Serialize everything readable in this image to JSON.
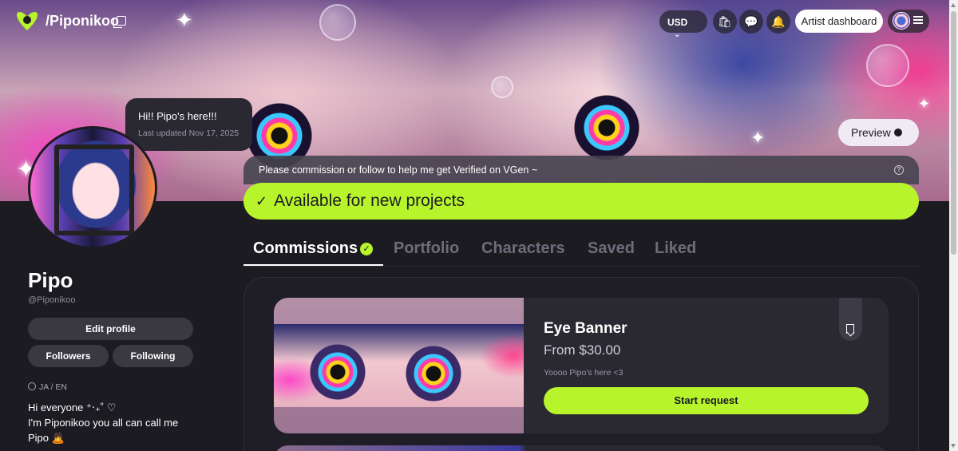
{
  "header": {
    "site_handle": "/Piponikoo",
    "currency": "USD",
    "artist_dashboard_label": "Artist dashboard",
    "icons": [
      "logo-icon",
      "copy-icon",
      "chevron-down-icon",
      "cart-icon",
      "chat-icon",
      "bell-icon",
      "avatar",
      "hamburger-icon"
    ]
  },
  "banner": {
    "preview_label": "Preview",
    "status_message": "Hi!! Pipo's here!!!",
    "status_updated": "Last updated Nov 17, 2025"
  },
  "profile": {
    "display_name": "Pipo",
    "handle": "@Piponikoo",
    "edit_profile_label": "Edit profile",
    "followers_label": "Followers",
    "following_label": "Following",
    "languages": "JA / EN",
    "bio_lines": [
      "Hi everyone ⁺‧₊˚ ♡",
      "I'm Piponikoo you all can call me",
      "Pipo 🙇"
    ]
  },
  "notice": {
    "verification": "Please commission or follow to help me get Verified on VGen ~",
    "availability": "Available for new projects"
  },
  "tabs": [
    {
      "label": "Commissions",
      "active": true
    },
    {
      "label": "Portfolio",
      "active": false
    },
    {
      "label": "Characters",
      "active": false
    },
    {
      "label": "Saved",
      "active": false
    },
    {
      "label": "Liked",
      "active": false
    }
  ],
  "commissions": [
    {
      "title": "Eye Banner",
      "price": "From $30.00",
      "description": "Yoooo Pipo's here <3",
      "cta": "Start request"
    }
  ],
  "colors": {
    "accent": "#b7f42c",
    "background": "#1c1b22",
    "card": "#2a2932"
  }
}
